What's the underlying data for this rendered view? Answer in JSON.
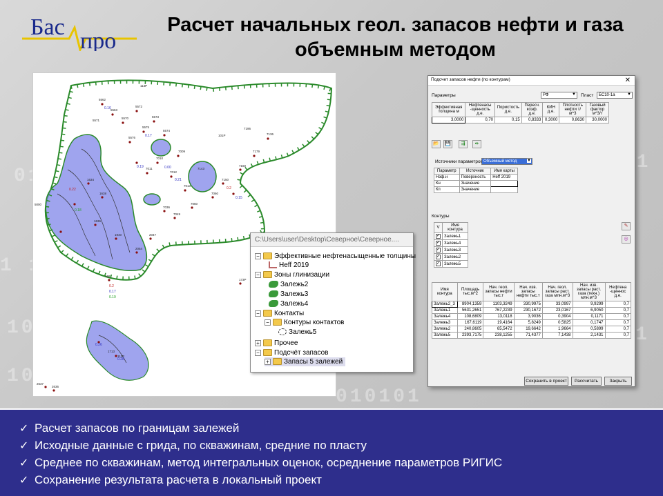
{
  "logo": {
    "text_left": "Бас",
    "text_right": "про"
  },
  "title": {
    "line1": "Расчет начальных геол. запасов нефти и газа",
    "line2": "объемным методом"
  },
  "map": {
    "well_labels": [
      "113Р",
      "5562",
      "5563",
      "5570",
      "5571",
      "5572",
      "5573",
      "5574",
      "5575",
      "5576",
      "5577",
      "7009",
      "7010",
      "7011",
      "7012",
      "7013",
      "7014",
      "7015",
      "7016",
      "7017",
      "7018",
      "7019",
      "7020",
      "7021",
      "7022",
      "7023",
      "7024",
      "7025",
      "7026",
      "7027",
      "7033",
      "7034",
      "7035",
      "7036",
      "7040",
      "7041",
      "7042",
      "7043",
      "7046",
      "7047",
      "7048",
      "7049",
      "7050",
      "7053",
      "7056",
      "7060",
      "7061",
      "7062",
      "7063",
      "7070",
      "7136",
      "7143",
      "7150",
      "7151",
      "7154",
      "7156",
      "7160",
      "7163",
      "7171",
      "7173",
      "7179",
      "7180",
      "7181",
      "7190",
      "7192",
      "7193",
      "7194",
      "7195",
      "7196",
      "7197",
      "7198",
      "101Р",
      "1687",
      "173Р",
      "112Р",
      "1638",
      "1634",
      "1636",
      "1940",
      "1941",
      "2047",
      "2054",
      "2055",
      "2057",
      "5000",
      "1713",
      "2637",
      "2636"
    ],
    "value_labels": [
      "0.16",
      "0.17",
      "0.18",
      "0.19",
      "0.22",
      "0.21",
      "0.00",
      "0.2",
      "0.15",
      "0.17",
      "0.19",
      "0.26",
      "0.28"
    ]
  },
  "tree": {
    "window_title": "C:\\Users\\user\\Desktop\\Северное\\Северное....",
    "items": [
      "Эффективные нефтенасыщенные толщины",
      "Heff 2019",
      "Зоны глинизации",
      "Залежь2",
      "Залежь3",
      "Залежь4",
      "Контакты",
      "Контуры контактов",
      "Залежь5",
      "Прочее",
      "Подсчёт запасов",
      "Запасы 5 залежей"
    ]
  },
  "dialog": {
    "title": "Подсчет запасов нефти (по контурам)",
    "close": "✕",
    "params_label": "Параметры",
    "params_value": "РФ",
    "plast_label": "Пласт",
    "plast_value": "БС10-1а",
    "params_headers": [
      "Эффективная толщина м",
      "Нефтенасы -щенность д.е.",
      "Пористость д.е.",
      "Пересч. коэф. д.е.",
      "КИН д.е.",
      "Плотность нефти т/м^3",
      "Газовый фактор м^3/т"
    ],
    "params_values": [
      "3,0000",
      "0,70",
      "0,15",
      "0,8333",
      "0,3000",
      "0,8630",
      "30,0000"
    ],
    "source_label": "Источники параметров",
    "source_value": "Объемный метод",
    "src_headers": [
      "Параметр",
      "Источник",
      "Имя карты"
    ],
    "src_rows": [
      [
        "Нэф.н",
        "Поверхность",
        "Heff 2019"
      ],
      [
        "Кн",
        "Значение",
        ""
      ],
      [
        "Кп",
        "Значение",
        ""
      ]
    ],
    "contours_label": "Контуры",
    "contours_headers": [
      "V",
      "Имя контура"
    ],
    "contours": [
      "Залежь1",
      "Залежь4",
      "Залежь3",
      "Залежь2",
      "Залежь5"
    ],
    "res_headers": [
      "Имя контура",
      "Площадь тыс.м^2",
      "Нач. геол. запасы нефти тыс.т",
      "Нач. изв. запасы нефти тыс.т",
      "Нач. геол. запасы раст. газа млн.м^3",
      "Нач. изв. запасы раст. газа (техн.) млн.м^3",
      "Нефтена -щеннос д.е."
    ],
    "res_rows": [
      [
        "Залежь2_3",
        "8904,1359",
        "1103,3249",
        "330,9975",
        "33,0997",
        "9,9299",
        "0,7"
      ],
      [
        "Залежь1",
        "5631,2651",
        "767,2239",
        "230,1672",
        "23,0167",
        "6,9050",
        "0,7"
      ],
      [
        "Залежь4",
        "108,6809",
        "13,0118",
        "3,9036",
        "0,3904",
        "0,1171",
        "0,7"
      ],
      [
        "Залежь3",
        "167,6119",
        "19,4164",
        "5,8249",
        "0,5825",
        "0,1747",
        "0,7"
      ],
      [
        "Залежь2",
        "240,8605",
        "65,5472",
        "19,6642",
        "1,9664",
        "0,5899",
        "0,7"
      ],
      [
        "Залежь5",
        "2393,7175",
        "238,1255",
        "71,4377",
        "7,1438",
        "2,1431",
        "0,7"
      ]
    ],
    "buttons": {
      "save": "Сохранить в проект",
      "calc": "Рассчитать",
      "close": "Закрыть"
    }
  },
  "bullets": [
    "Расчет запасов по границам залежей",
    "Исходные данные с грида, по скважинам, средние по пласту",
    "Среднее по скважинам, метод интегральных оценок, осреднение параметров РИГИС",
    "Сохранение результата расчета в локальный проект"
  ]
}
